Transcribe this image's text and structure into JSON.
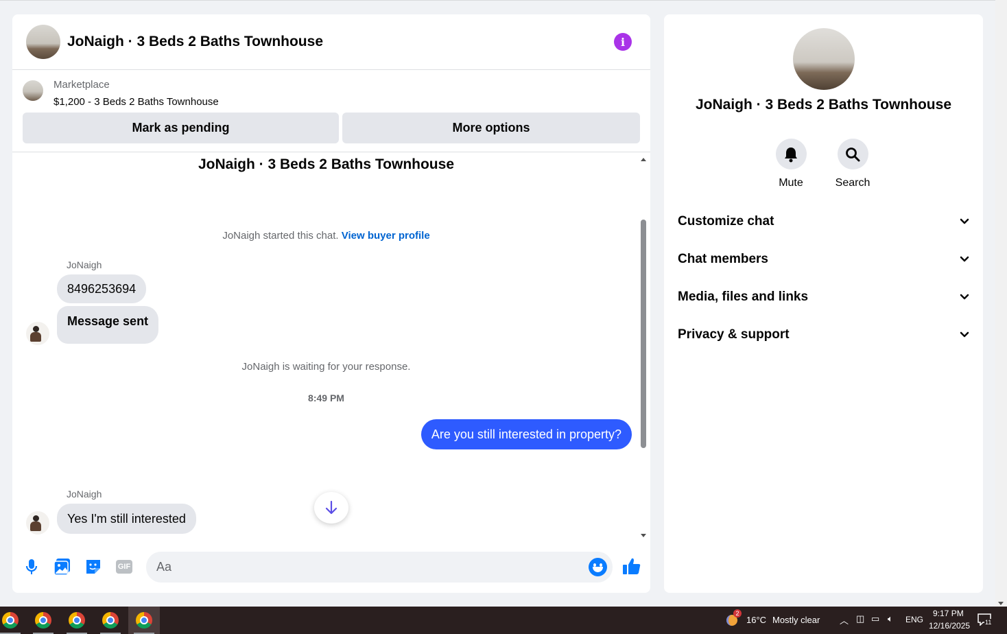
{
  "chat": {
    "header_title": "JoNaigh · 3 Beds 2 Baths Townhouse",
    "info_icon": "i",
    "listing": {
      "source": "Marketplace",
      "price_title": "$1,200 - 3 Beds 2 Baths Townhouse",
      "mark_pending_label": "Mark as pending",
      "more_options_label": "More options"
    },
    "conversation_title": "JoNaigh · 3 Beds 2 Baths Townhouse",
    "started_text": "JoNaigh started this chat.",
    "view_profile_link": "View buyer profile",
    "messages": [
      {
        "sender": "JoNaigh",
        "text": "8496253694"
      },
      {
        "text": "Message sent"
      }
    ],
    "waiting_text": "JoNaigh is waiting for your response.",
    "timestamp": "8:49 PM",
    "outgoing_message": "Are you still interested in property?",
    "reply_sender": "JoNaigh",
    "reply_text": "Yes I'm still interested",
    "composer_placeholder": "Aa",
    "gif_label": "GIF"
  },
  "side": {
    "title": "JoNaigh · 3 Beds 2 Baths Townhouse",
    "mute_label": "Mute",
    "search_label": "Search",
    "sections": [
      "Customize chat",
      "Chat members",
      "Media, files and links",
      "Privacy & support"
    ]
  },
  "taskbar": {
    "weather_badge": "2",
    "temperature": "16°C",
    "weather_text": "Mostly clear",
    "language": "ENG",
    "time": "9:17 PM",
    "date": "12/16/2025",
    "notification_count": "11"
  },
  "colors": {
    "accent_blue": "#0a7cff",
    "outgoing_bubble": "#2e5bff",
    "info_purple": "#a933e8",
    "link_blue": "#0064d1"
  }
}
